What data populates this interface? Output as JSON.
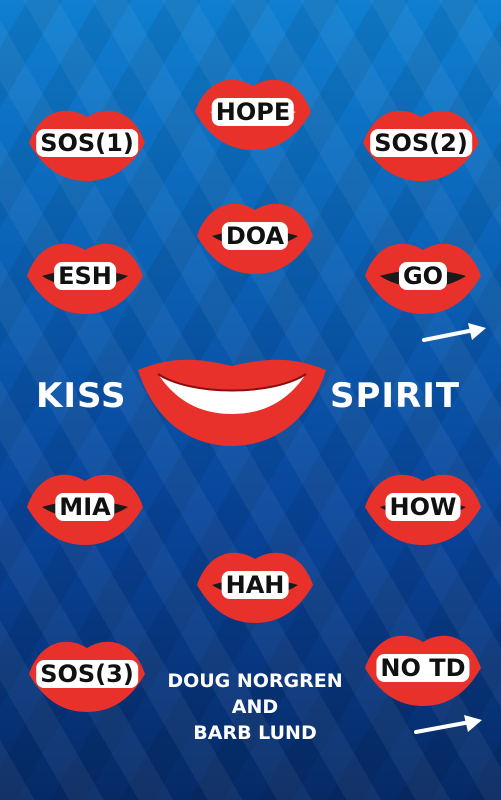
{
  "colors": {
    "lip_red": "#e8312a",
    "lip_outline": "#8a0f10",
    "teeth": "#ffffff",
    "text": "#111111"
  },
  "lips": [
    {
      "label": "HOPE"
    },
    {
      "label": "SOS(1)"
    },
    {
      "label": "SOS(2)"
    },
    {
      "label": "DOA"
    },
    {
      "label": "ESH"
    },
    {
      "label": "GO"
    },
    {
      "label": "MIA"
    },
    {
      "label": "HOW"
    },
    {
      "label": "HAH"
    },
    {
      "label": "SOS(3)"
    },
    {
      "label": "NO TD"
    }
  ],
  "center": {
    "left_word": "KISS",
    "right_word": "SPIRIT"
  },
  "authors": {
    "line1": "DOUG NORGREN",
    "line2": "AND",
    "line3": "BARB LUND"
  },
  "icons": {
    "arrow": "right-arrow-icon",
    "smile": "smiling-lips-icon"
  }
}
